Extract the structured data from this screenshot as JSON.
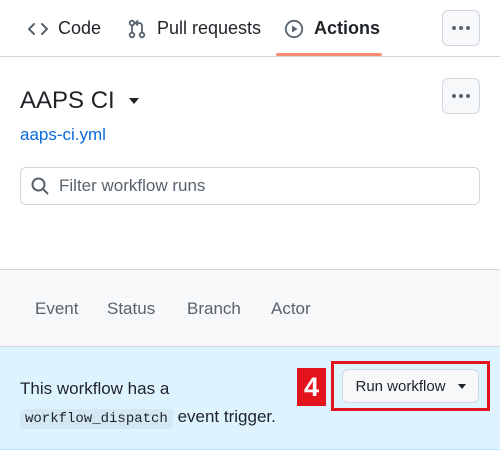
{
  "nav": {
    "tabs": [
      {
        "label": "Code",
        "icon": "code-icon"
      },
      {
        "label": "Pull requests",
        "icon": "git-pull-request-icon"
      },
      {
        "label": "Actions",
        "icon": "play-icon",
        "selected": true
      }
    ],
    "more_icon": "kebab-horizontal-icon"
  },
  "workflow": {
    "title": "AAPS CI",
    "file": "aaps-ci.yml"
  },
  "search": {
    "placeholder": "Filter workflow runs"
  },
  "filters": [
    "Event",
    "Status",
    "Branch",
    "Actor"
  ],
  "banner": {
    "text_before": "This workflow has a",
    "code": "workflow_dispatch",
    "text_after": "event trigger.",
    "step_number": "4",
    "run_button": "Run workflow"
  },
  "colors": {
    "accent_underline": "#fd8c73",
    "link": "#0969da",
    "banner_bg": "#ddf4ff",
    "highlight": "#e3141d"
  }
}
